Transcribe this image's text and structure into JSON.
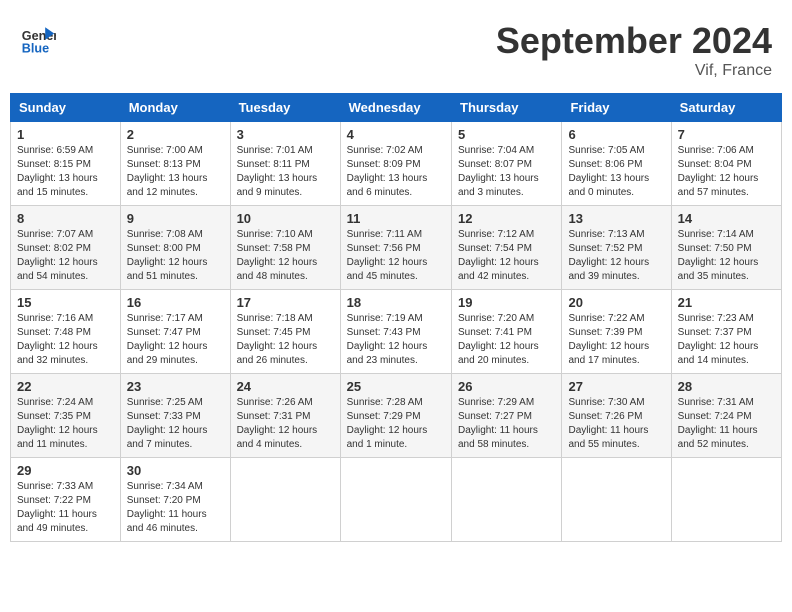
{
  "header": {
    "logo_line1": "General",
    "logo_line2": "Blue",
    "month": "September 2024",
    "location": "Vif, France"
  },
  "days_of_week": [
    "Sunday",
    "Monday",
    "Tuesday",
    "Wednesday",
    "Thursday",
    "Friday",
    "Saturday"
  ],
  "weeks": [
    [
      {
        "day": "1",
        "lines": [
          "Sunrise: 6:59 AM",
          "Sunset: 8:15 PM",
          "Daylight: 13 hours",
          "and 15 minutes."
        ]
      },
      {
        "day": "2",
        "lines": [
          "Sunrise: 7:00 AM",
          "Sunset: 8:13 PM",
          "Daylight: 13 hours",
          "and 12 minutes."
        ]
      },
      {
        "day": "3",
        "lines": [
          "Sunrise: 7:01 AM",
          "Sunset: 8:11 PM",
          "Daylight: 13 hours",
          "and 9 minutes."
        ]
      },
      {
        "day": "4",
        "lines": [
          "Sunrise: 7:02 AM",
          "Sunset: 8:09 PM",
          "Daylight: 13 hours",
          "and 6 minutes."
        ]
      },
      {
        "day": "5",
        "lines": [
          "Sunrise: 7:04 AM",
          "Sunset: 8:07 PM",
          "Daylight: 13 hours",
          "and 3 minutes."
        ]
      },
      {
        "day": "6",
        "lines": [
          "Sunrise: 7:05 AM",
          "Sunset: 8:06 PM",
          "Daylight: 13 hours",
          "and 0 minutes."
        ]
      },
      {
        "day": "7",
        "lines": [
          "Sunrise: 7:06 AM",
          "Sunset: 8:04 PM",
          "Daylight: 12 hours",
          "and 57 minutes."
        ]
      }
    ],
    [
      {
        "day": "8",
        "lines": [
          "Sunrise: 7:07 AM",
          "Sunset: 8:02 PM",
          "Daylight: 12 hours",
          "and 54 minutes."
        ]
      },
      {
        "day": "9",
        "lines": [
          "Sunrise: 7:08 AM",
          "Sunset: 8:00 PM",
          "Daylight: 12 hours",
          "and 51 minutes."
        ]
      },
      {
        "day": "10",
        "lines": [
          "Sunrise: 7:10 AM",
          "Sunset: 7:58 PM",
          "Daylight: 12 hours",
          "and 48 minutes."
        ]
      },
      {
        "day": "11",
        "lines": [
          "Sunrise: 7:11 AM",
          "Sunset: 7:56 PM",
          "Daylight: 12 hours",
          "and 45 minutes."
        ]
      },
      {
        "day": "12",
        "lines": [
          "Sunrise: 7:12 AM",
          "Sunset: 7:54 PM",
          "Daylight: 12 hours",
          "and 42 minutes."
        ]
      },
      {
        "day": "13",
        "lines": [
          "Sunrise: 7:13 AM",
          "Sunset: 7:52 PM",
          "Daylight: 12 hours",
          "and 39 minutes."
        ]
      },
      {
        "day": "14",
        "lines": [
          "Sunrise: 7:14 AM",
          "Sunset: 7:50 PM",
          "Daylight: 12 hours",
          "and 35 minutes."
        ]
      }
    ],
    [
      {
        "day": "15",
        "lines": [
          "Sunrise: 7:16 AM",
          "Sunset: 7:48 PM",
          "Daylight: 12 hours",
          "and 32 minutes."
        ]
      },
      {
        "day": "16",
        "lines": [
          "Sunrise: 7:17 AM",
          "Sunset: 7:47 PM",
          "Daylight: 12 hours",
          "and 29 minutes."
        ]
      },
      {
        "day": "17",
        "lines": [
          "Sunrise: 7:18 AM",
          "Sunset: 7:45 PM",
          "Daylight: 12 hours",
          "and 26 minutes."
        ]
      },
      {
        "day": "18",
        "lines": [
          "Sunrise: 7:19 AM",
          "Sunset: 7:43 PM",
          "Daylight: 12 hours",
          "and 23 minutes."
        ]
      },
      {
        "day": "19",
        "lines": [
          "Sunrise: 7:20 AM",
          "Sunset: 7:41 PM",
          "Daylight: 12 hours",
          "and 20 minutes."
        ]
      },
      {
        "day": "20",
        "lines": [
          "Sunrise: 7:22 AM",
          "Sunset: 7:39 PM",
          "Daylight: 12 hours",
          "and 17 minutes."
        ]
      },
      {
        "day": "21",
        "lines": [
          "Sunrise: 7:23 AM",
          "Sunset: 7:37 PM",
          "Daylight: 12 hours",
          "and 14 minutes."
        ]
      }
    ],
    [
      {
        "day": "22",
        "lines": [
          "Sunrise: 7:24 AM",
          "Sunset: 7:35 PM",
          "Daylight: 12 hours",
          "and 11 minutes."
        ]
      },
      {
        "day": "23",
        "lines": [
          "Sunrise: 7:25 AM",
          "Sunset: 7:33 PM",
          "Daylight: 12 hours",
          "and 7 minutes."
        ]
      },
      {
        "day": "24",
        "lines": [
          "Sunrise: 7:26 AM",
          "Sunset: 7:31 PM",
          "Daylight: 12 hours",
          "and 4 minutes."
        ]
      },
      {
        "day": "25",
        "lines": [
          "Sunrise: 7:28 AM",
          "Sunset: 7:29 PM",
          "Daylight: 12 hours",
          "and 1 minute."
        ]
      },
      {
        "day": "26",
        "lines": [
          "Sunrise: 7:29 AM",
          "Sunset: 7:27 PM",
          "Daylight: 11 hours",
          "and 58 minutes."
        ]
      },
      {
        "day": "27",
        "lines": [
          "Sunrise: 7:30 AM",
          "Sunset: 7:26 PM",
          "Daylight: 11 hours",
          "and 55 minutes."
        ]
      },
      {
        "day": "28",
        "lines": [
          "Sunrise: 7:31 AM",
          "Sunset: 7:24 PM",
          "Daylight: 11 hours",
          "and 52 minutes."
        ]
      }
    ],
    [
      {
        "day": "29",
        "lines": [
          "Sunrise: 7:33 AM",
          "Sunset: 7:22 PM",
          "Daylight: 11 hours",
          "and 49 minutes."
        ]
      },
      {
        "day": "30",
        "lines": [
          "Sunrise: 7:34 AM",
          "Sunset: 7:20 PM",
          "Daylight: 11 hours",
          "and 46 minutes."
        ]
      },
      null,
      null,
      null,
      null,
      null
    ]
  ]
}
